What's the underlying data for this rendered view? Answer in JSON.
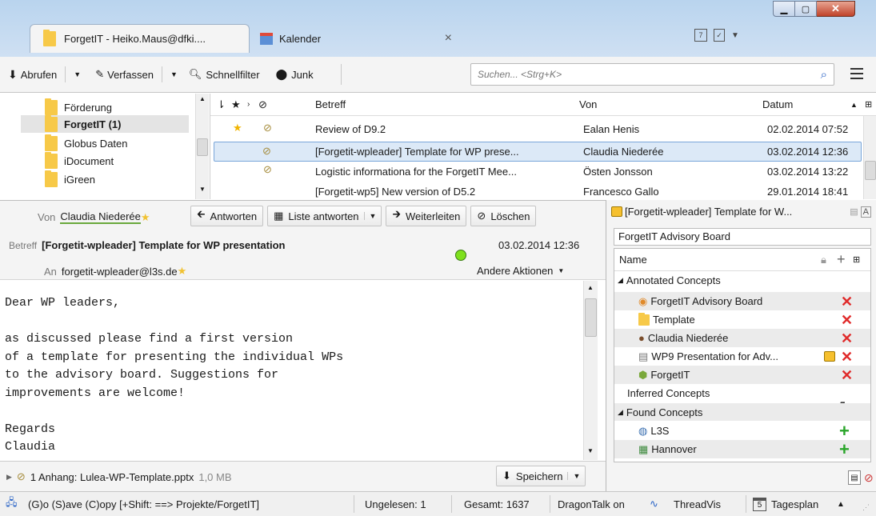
{
  "window": {
    "tabs": [
      {
        "label": "ForgetIT - Heiko.Maus@dfki...."
      },
      {
        "label": "Kalender"
      }
    ],
    "tab_close": "×"
  },
  "toolbar": {
    "get": "Abrufen",
    "write": "Verfassen",
    "quickfilter": "Schnellfilter",
    "junk": "Junk",
    "search_placeholder": "Suchen... <Strg+K>"
  },
  "folders": [
    "Förderung",
    "ForgetIT (1)",
    "Globus Daten",
    "iDocument",
    "iGreen"
  ],
  "message_list": {
    "col_subject": "Betreff",
    "col_from": "Von",
    "col_date": "Datum",
    "rows": [
      {
        "subject": "Review of D9.2",
        "from": "Ealan Henis",
        "date": "02.02.2014 07:52"
      },
      {
        "subject": "[Forgetit-wpleader] Template for WP prese...",
        "from": "Claudia Niederée",
        "date": "03.02.2014 12:36"
      },
      {
        "subject": "Logistic informationa for the ForgetIT Mee...",
        "from": "Östen Jonsson",
        "date": "03.02.2014 13:22"
      },
      {
        "subject": "[Forgetit-wp5] New version of D5.2",
        "from": "Francesco Gallo",
        "date": "29.01.2014 18:41"
      }
    ]
  },
  "header": {
    "from_label": "Von",
    "from": "Claudia Niederée",
    "subject_label": "Betreff",
    "subject": "[Forgetit-wpleader] Template for WP presentation",
    "to_label": "An",
    "to": "forgetit-wpleader@l3s.de",
    "date": "03.02.2014 12:36",
    "reply": "Antworten",
    "reply_list": "Liste antworten",
    "forward": "Weiterleiten",
    "delete": "Löschen",
    "other_actions": "Andere Aktionen"
  },
  "body": [
    "Dear WP leaders,",
    "",
    "as discussed please find a first version",
    "of a template for presenting the individual WPs",
    "to the advisory board. Suggestions for",
    "improvements are welcome!",
    "",
    "Regards",
    "Claudia"
  ],
  "attachment": {
    "label": "1 Anhang: Lulea-WP-Template.pptx",
    "size": "1,0 MB",
    "save": "Speichern"
  },
  "side_panel": {
    "title": "[Forgetit-wpleader] Template for W...",
    "field": "ForgetIT Advisory Board",
    "col_name": "Name",
    "annotated_label": "Annotated Concepts",
    "annotated": [
      "ForgetIT Advisory Board",
      "Template",
      "Claudia Niederée",
      "WP9 Presentation for Adv...",
      "ForgetIT"
    ],
    "inferred_label": "Inferred Concepts",
    "found_label": "Found Concepts",
    "found": [
      "L3S",
      "Hannover"
    ]
  },
  "status": {
    "command": "(G)o (S)ave (C)opy [+Shift: ==> Projekte/ForgetIT]",
    "unread": "Ungelesen: 1",
    "total": "Gesamt: 1637",
    "dragontalk": "DragonTalk on",
    "threadvis": "ThreadVis",
    "calendar_day": "5",
    "tagesplan": "Tagesplan"
  }
}
